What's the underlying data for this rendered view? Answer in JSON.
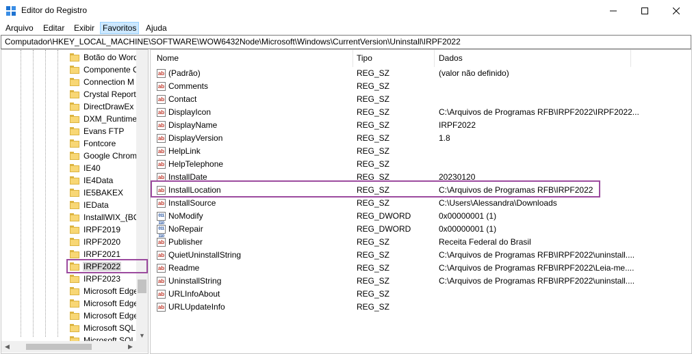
{
  "window": {
    "title": "Editor do Registro"
  },
  "menu": [
    "Arquivo",
    "Editar",
    "Exibir",
    "Favoritos",
    "Ajuda"
  ],
  "address": "Computador\\HKEY_LOCAL_MACHINE\\SOFTWARE\\WOW6432Node\\Microsoft\\Windows\\CurrentVersion\\Uninstall\\IRPF2022",
  "tree": [
    "Botão do Word",
    "Componente C",
    "Connection M",
    "Crystal Reports",
    "DirectDrawEx",
    "DXM_Runtime",
    "Evans FTP",
    "Fontcore",
    "Google Chrom",
    "IE40",
    "IE4Data",
    "IE5BAKEX",
    "IEData",
    "InstallWIX_{BC",
    "IRPF2019",
    "IRPF2020",
    "IRPF2021",
    "IRPF2022",
    "IRPF2023",
    "Microsoft Edge",
    "Microsoft Edge",
    "Microsoft Edge",
    "Microsoft SQL",
    "Microsoft SQL"
  ],
  "tree_selected": "IRPF2022",
  "columns": {
    "name": "Nome",
    "type": "Tipo",
    "data": "Dados"
  },
  "icons": {
    "string": "ab",
    "dword": "011 110"
  },
  "rows": [
    {
      "name": "(Padrão)",
      "type": "REG_SZ",
      "data": "(valor não definido)",
      "kind": "string"
    },
    {
      "name": "Comments",
      "type": "REG_SZ",
      "data": "",
      "kind": "string"
    },
    {
      "name": "Contact",
      "type": "REG_SZ",
      "data": "",
      "kind": "string"
    },
    {
      "name": "DisplayIcon",
      "type": "REG_SZ",
      "data": "C:\\Arquivos de Programas RFB\\IRPF2022\\IRPF2022...",
      "kind": "string"
    },
    {
      "name": "DisplayName",
      "type": "REG_SZ",
      "data": "IRPF2022",
      "kind": "string"
    },
    {
      "name": "DisplayVersion",
      "type": "REG_SZ",
      "data": "1.8",
      "kind": "string"
    },
    {
      "name": "HelpLink",
      "type": "REG_SZ",
      "data": "",
      "kind": "string"
    },
    {
      "name": "HelpTelephone",
      "type": "REG_SZ",
      "data": "",
      "kind": "string"
    },
    {
      "name": "InstallDate",
      "type": "REG_SZ",
      "data": "20230120",
      "kind": "string"
    },
    {
      "name": "InstallLocation",
      "type": "REG_SZ",
      "data": "C:\\Arquivos de Programas RFB\\IRPF2022",
      "kind": "string"
    },
    {
      "name": "InstallSource",
      "type": "REG_SZ",
      "data": "C:\\Users\\Alessandra\\Downloads",
      "kind": "string"
    },
    {
      "name": "NoModify",
      "type": "REG_DWORD",
      "data": "0x00000001 (1)",
      "kind": "dword"
    },
    {
      "name": "NoRepair",
      "type": "REG_DWORD",
      "data": "0x00000001 (1)",
      "kind": "dword"
    },
    {
      "name": "Publisher",
      "type": "REG_SZ",
      "data": "Receita Federal do Brasil",
      "kind": "string"
    },
    {
      "name": "QuietUninstallString",
      "type": "REG_SZ",
      "data": "C:\\Arquivos de Programas RFB\\IRPF2022\\uninstall....",
      "kind": "string"
    },
    {
      "name": "Readme",
      "type": "REG_SZ",
      "data": "C:\\Arquivos de Programas RFB\\IRPF2022\\Leia-me....",
      "kind": "string"
    },
    {
      "name": "UninstallString",
      "type": "REG_SZ",
      "data": "C:\\Arquivos de Programas RFB\\IRPF2022\\uninstall....",
      "kind": "string"
    },
    {
      "name": "URLInfoAbout",
      "type": "REG_SZ",
      "data": "",
      "kind": "string"
    },
    {
      "name": "URLUpdateInfo",
      "type": "REG_SZ",
      "data": "",
      "kind": "string"
    }
  ],
  "highlighted_value": "InstallLocation",
  "colors": {
    "highlight_border": "#9b4a9e",
    "menu_active_bg": "#cce8ff",
    "folder": "#f8d775"
  }
}
